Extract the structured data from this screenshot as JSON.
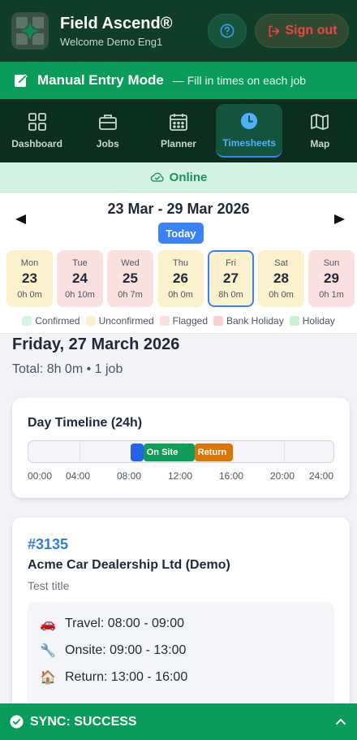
{
  "header": {
    "title": "Field Ascend®",
    "subtitle": "Welcome Demo Eng1",
    "help_icon": "question-circle-icon",
    "signout_label": "Sign out",
    "signout_icon": "logout-icon",
    "colors": {
      "bg": "#0f3d28",
      "signout_text": "#ef4444"
    }
  },
  "manual_mode": {
    "title": "Manual Entry Mode",
    "subtitle": "— Fill in times on each job",
    "icon": "edit-note-icon",
    "color": "#0b9b5b"
  },
  "nav": {
    "items": [
      {
        "label": "Dashboard",
        "icon": "grid-icon",
        "active": false
      },
      {
        "label": "Jobs",
        "icon": "briefcase-icon",
        "active": false
      },
      {
        "label": "Planner",
        "icon": "calendar-icon",
        "active": false
      },
      {
        "label": "Timesheets",
        "icon": "clock-icon",
        "active": true
      },
      {
        "label": "Map",
        "icon": "map-icon",
        "active": false
      }
    ],
    "active_color": "#4fb0ff"
  },
  "status": {
    "label": "Online",
    "icon": "cloud-check-icon",
    "color": "#169456"
  },
  "week": {
    "range": "23 Mar - 29 Mar 2026",
    "today_label": "Today",
    "prev_icon": "triangle-left-icon",
    "next_icon": "triangle-right-icon",
    "days": [
      {
        "name": "Mon",
        "date": "23",
        "hours": "0h 0m",
        "state": "unconfirmed"
      },
      {
        "name": "Tue",
        "date": "24",
        "hours": "0h 10m",
        "state": "flagged"
      },
      {
        "name": "Wed",
        "date": "25",
        "hours": "0h 7m",
        "state": "flagged"
      },
      {
        "name": "Thu",
        "date": "26",
        "hours": "0h 0m",
        "state": "unconfirmed"
      },
      {
        "name": "Fri",
        "date": "27",
        "hours": "8h 0m",
        "state": "unconfirmed",
        "selected": true
      },
      {
        "name": "Sat",
        "date": "28",
        "hours": "0h 0m",
        "state": "unconfirmed"
      },
      {
        "name": "Sun",
        "date": "29",
        "hours": "0h 1m",
        "state": "flagged"
      }
    ],
    "legend": [
      {
        "label": "Confirmed",
        "color": "#d6f5e3"
      },
      {
        "label": "Unconfirmed",
        "color": "#fbf1cc"
      },
      {
        "label": "Flagged",
        "color": "#fbe0e0"
      },
      {
        "label": "Bank Holiday",
        "color": "#fbcfd2"
      },
      {
        "label": "Holiday",
        "color": "#c8f1d6"
      }
    ]
  },
  "day": {
    "title": "Friday, 27 March 2026",
    "total": "Total: 8h 0m • 1 job"
  },
  "timeline": {
    "title": "Day Timeline (24h)",
    "hours_span": 24,
    "labels": [
      "00:00",
      "04:00",
      "08:00",
      "12:00",
      "16:00",
      "20:00",
      "24:00"
    ],
    "segments": [
      {
        "label": "",
        "start": 8,
        "end": 9,
        "color": "#2563eb"
      },
      {
        "label": "On Site",
        "start": 9,
        "end": 13,
        "color": "#0f9d58"
      },
      {
        "label": "Return",
        "start": 13,
        "end": 16,
        "color": "#d97706"
      }
    ]
  },
  "job": {
    "number": "#3135",
    "client": "Acme Car Dealership Ltd (Demo)",
    "title": "Test title",
    "times": [
      {
        "icon": "car-icon",
        "glyph": "🚗",
        "text": "Travel: 08:00 - 09:00"
      },
      {
        "icon": "wrench-icon",
        "glyph": "🔧",
        "text": "Onsite: 09:00 - 13:00"
      },
      {
        "icon": "house-icon",
        "glyph": "🏠",
        "text": "Return: 13:00 - 16:00"
      }
    ]
  },
  "sync": {
    "label": "SYNC: SUCCESS",
    "icon": "check-circle-icon",
    "expand_icon": "chevron-up-icon"
  }
}
